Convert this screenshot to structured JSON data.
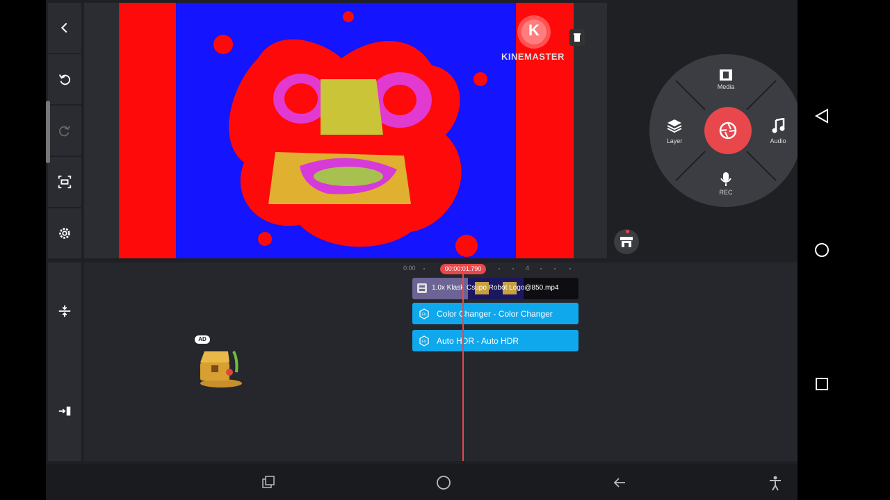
{
  "preview": {
    "watermark_text": "KINEMASTER",
    "logo_letter": "K"
  },
  "wheel": {
    "media_label": "Media",
    "layer_label": "Layer",
    "audio_label": "Audio",
    "rec_label": "REC"
  },
  "timeline": {
    "start_time": "0:00",
    "playhead_time": "00:00:01.790",
    "tick_label": "4",
    "ad_badge": "AD",
    "video_clip_speed": "1.0x Klask",
    "video_clip_name": "Csupo Robot Logo@850.mp4",
    "tracks": [
      {
        "label": "Color Changer - Color Changer"
      },
      {
        "label": "Auto HDR - Auto HDR"
      }
    ]
  },
  "colors": {
    "accent": "#e8474c",
    "track_blue": "#10a8ec",
    "background": "#1f2024"
  }
}
